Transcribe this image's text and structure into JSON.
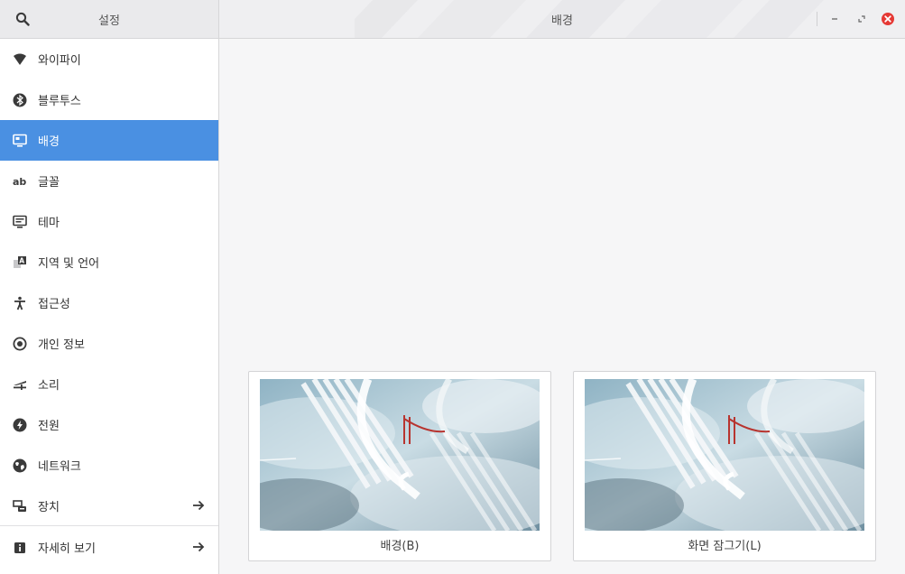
{
  "header": {
    "sidebar_title": "설정",
    "page_title": "배경",
    "search_icon": "search-icon",
    "minimize_icon": "minimize-icon",
    "maximize_icon": "maximize-icon",
    "close_icon": "close-icon",
    "close_color": "#e53935"
  },
  "sidebar": {
    "accent": "#4a90e2",
    "items": [
      {
        "label": "와이파이",
        "icon": "wifi-icon"
      },
      {
        "label": "블루투스",
        "icon": "bluetooth-icon"
      },
      {
        "label": "배경",
        "icon": "wallpaper-icon",
        "active": true
      },
      {
        "label": "글꼴",
        "icon": "font-icon"
      },
      {
        "label": "테마",
        "icon": "theme-icon"
      },
      {
        "label": "지역 및 언어",
        "icon": "language-icon"
      },
      {
        "label": "접근성",
        "icon": "accessibility-icon"
      },
      {
        "label": "개인 정보",
        "icon": "privacy-icon"
      },
      {
        "label": "소리",
        "icon": "sound-icon"
      },
      {
        "label": "전원",
        "icon": "power-icon"
      },
      {
        "label": "네트워크",
        "icon": "network-icon"
      },
      {
        "label": "장치",
        "icon": "devices-icon",
        "arrow": true
      },
      {
        "label": "자세히 보기",
        "icon": "info-icon",
        "arrow": true
      }
    ]
  },
  "main": {
    "cards": [
      {
        "label": "배경(B)",
        "icon": "wallpaper-thumbnail"
      },
      {
        "label": "화면 잠그기(L)",
        "icon": "lockscreen-thumbnail"
      }
    ]
  }
}
